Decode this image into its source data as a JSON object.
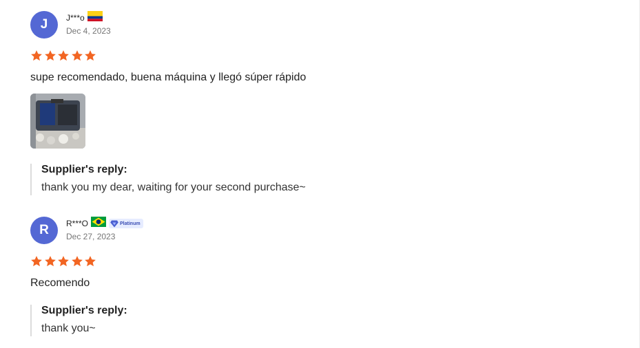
{
  "colors": {
    "avatar": "#5468d4",
    "star": "#f26522",
    "badge_bg": "#e6ecff",
    "badge_text": "#3b4eb3"
  },
  "reviews": [
    {
      "avatar_letter": "J",
      "name": "J***o",
      "flag": "colombia-flag-icon",
      "date": "Dec 4, 2023",
      "rating": 5,
      "text": "supe recomendado, buena máquina y llegó súper rápido",
      "has_photo": true,
      "reply_title": "Supplier's reply:",
      "reply_text": "thank you my dear, waiting for your second purchase~"
    },
    {
      "avatar_letter": "R",
      "name": "R***O",
      "flag": "brazil-flag-icon",
      "badge": "Platinum",
      "date": "Dec 27, 2023",
      "rating": 5,
      "text": "Recomendo",
      "has_photo": false,
      "reply_title": "Supplier's reply:",
      "reply_text": "thank you~"
    }
  ]
}
